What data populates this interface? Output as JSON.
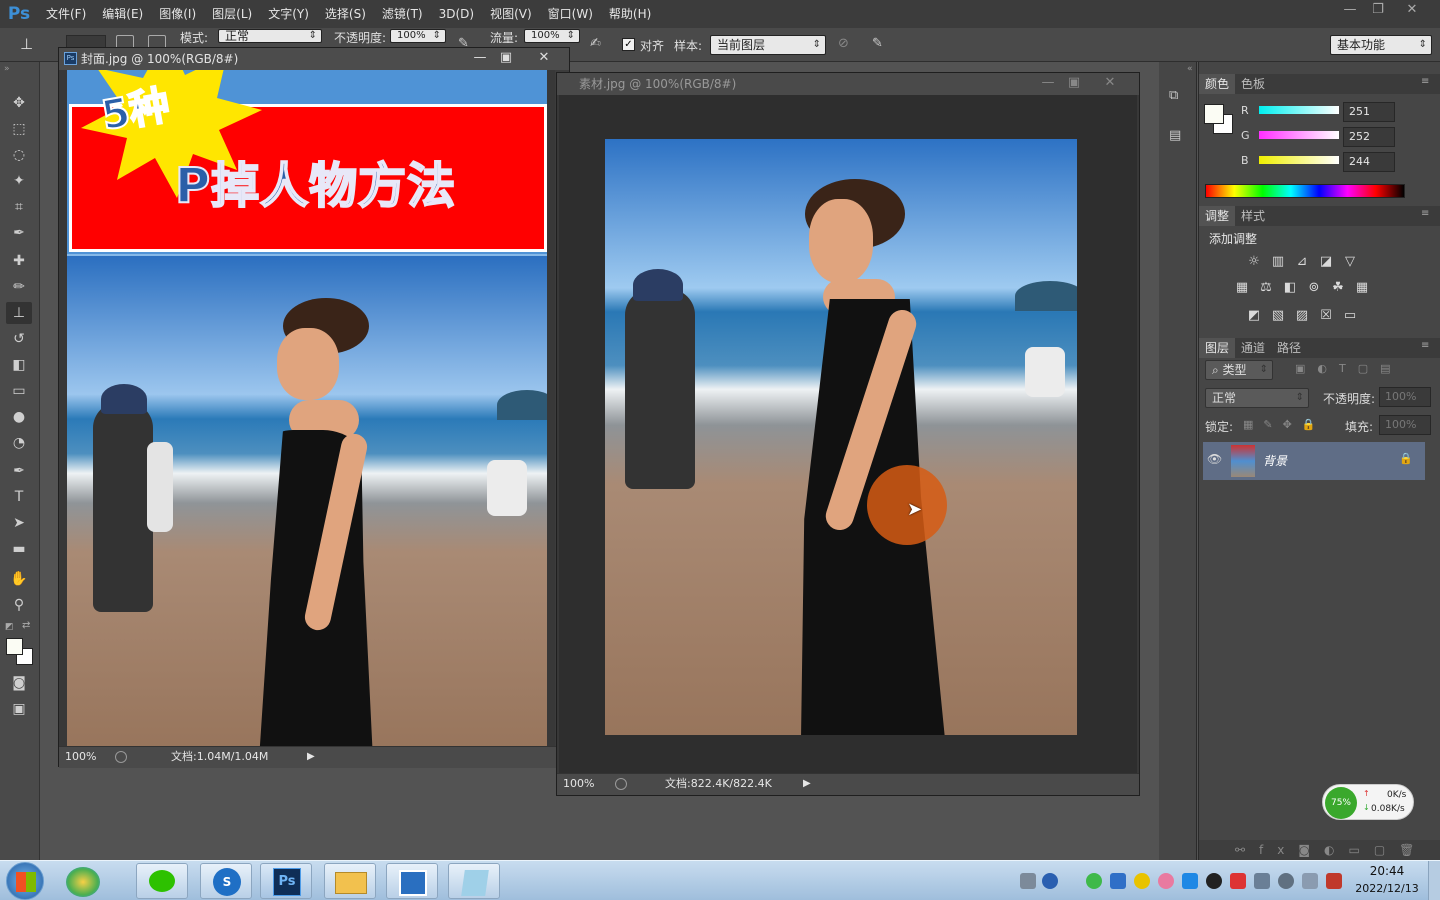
{
  "app": {
    "logo": "Ps"
  },
  "menu": [
    "文件(F)",
    "编辑(E)",
    "图像(I)",
    "图层(L)",
    "文字(Y)",
    "选择(S)",
    "滤镜(T)",
    "3D(D)",
    "视图(V)",
    "窗口(W)",
    "帮助(H)"
  ],
  "options": {
    "mode_label": "模式:",
    "mode_value": "正常",
    "opacity_label": "不透明度:",
    "opacity_value": "100%",
    "flow_label": "流量:",
    "flow_value": "100%",
    "align_label": "对齐",
    "sample_label": "样本:",
    "sample_value": "当前图层",
    "workspace": "基本功能"
  },
  "doc1": {
    "title": "封面.jpg @ 100%(RGB/8#)",
    "zoom": "100%",
    "docinfo": "文档:1.04M/1.04M",
    "banner_badge": "5种",
    "banner_text": "P掉人物方法"
  },
  "doc2": {
    "title": "素材.jpg @ 100%(RGB/8#)",
    "zoom": "100%",
    "docinfo": "文档:822.4K/822.4K"
  },
  "color_panel": {
    "tabs": [
      "颜色",
      "色板"
    ],
    "r_label": "R",
    "r_value": "251",
    "g_label": "G",
    "g_value": "252",
    "b_label": "B",
    "b_value": "244",
    "foreground": "#fbfcf4"
  },
  "adjust_panel": {
    "tabs": [
      "调整",
      "样式"
    ],
    "title": "添加调整"
  },
  "layers_panel": {
    "tabs": [
      "图层",
      "通道",
      "路径"
    ],
    "filter_kind": "类型",
    "blend_mode": "正常",
    "opacity_label": "不透明度:",
    "opacity_value": "100%",
    "lock_label": "锁定:",
    "fill_label": "填充:",
    "fill_value": "100%",
    "layer_name": "背景"
  },
  "net_widget": {
    "percent": "75%",
    "up": "0K/s",
    "down": "0.08K/s"
  },
  "taskbar": {
    "time": "20:44",
    "date": "2022/12/13",
    "ps_label": "Ps"
  },
  "colors": {
    "accent": "#3d8fd6",
    "banner_red": "#ff0000",
    "burst_yellow": "#ffe600"
  }
}
